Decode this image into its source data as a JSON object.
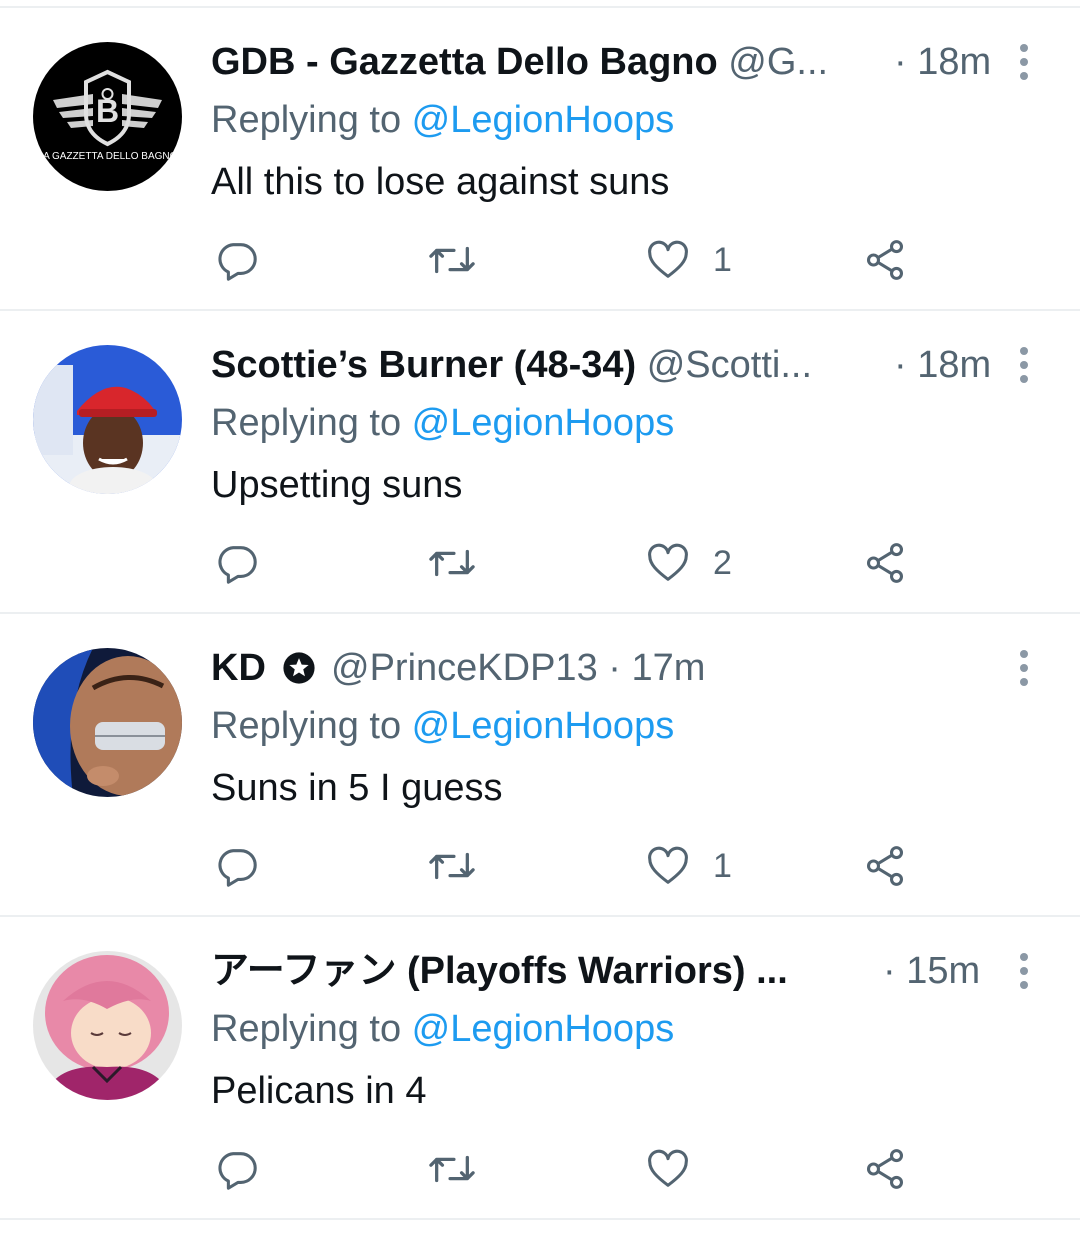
{
  "colors": {
    "text_primary": "#0f1419",
    "text_secondary": "#536471",
    "mention": "#1d9bf0",
    "divider": "#eceff1"
  },
  "icons": {
    "reply": "reply-icon",
    "retweet": "retweet-icon",
    "like": "heart-icon",
    "share": "share-icon",
    "more": "more-vertical-icon",
    "verified": "star-badge-icon"
  },
  "tweets": [
    {
      "name": "GDB - Gazzetta Dello Bagno",
      "handle": "@G...",
      "time": "· 18m",
      "replying_prefix": "Replying to ",
      "replying_to": "@LegionHoops",
      "text": "All this to lose against suns",
      "likes": "1",
      "avatar_caption": "LA GAZZETTA DELLO BAGNO"
    },
    {
      "name": "Scottie’s Burner (48-34)",
      "handle": "@Scotti...",
      "time": "· 18m",
      "replying_prefix": "Replying to ",
      "replying_to": "@LegionHoops",
      "text": "Upsetting suns",
      "likes": "2"
    },
    {
      "name": "KD",
      "handle": "@PrinceKDP13",
      "time": "· 17m",
      "replying_prefix": "Replying to ",
      "replying_to": "@LegionHoops",
      "text": "Suns in 5 I guess",
      "likes": "1"
    },
    {
      "name": "アーファン (Playoffs Warriors) ...",
      "handle": "",
      "time": "· 15m",
      "replying_prefix": "Replying to ",
      "replying_to": "@LegionHoops",
      "text": "Pelicans in 4",
      "likes": ""
    }
  ]
}
